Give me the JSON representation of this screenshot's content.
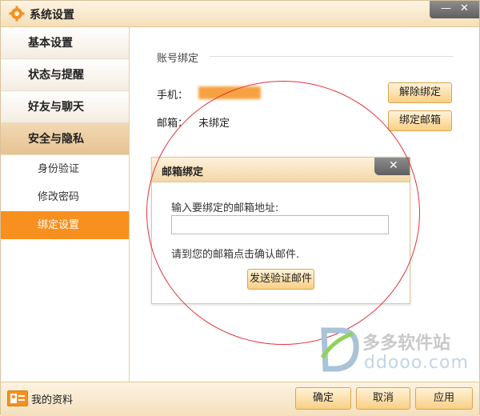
{
  "window": {
    "title": "系统设置",
    "min_icon": "minimize-icon",
    "close_icon": "close-icon"
  },
  "sidebar": {
    "categories": [
      "基本设置",
      "状态与提醒",
      "好友与聊天",
      "安全与隐私"
    ],
    "subitems": [
      "身份验证",
      "修改密码",
      "绑定设置"
    ],
    "active_category": "安全与隐私",
    "active_subitem": "绑定设置"
  },
  "content": {
    "section_title": "账号绑定",
    "phone_label": "手机：",
    "email_label": "邮箱：",
    "email_value": "未绑定",
    "unbind_button": "解除绑定",
    "bind_email_button": "绑定邮箱"
  },
  "dialog": {
    "title": "邮箱绑定",
    "input_label": "输入要绑定的邮箱地址:",
    "input_value": "",
    "note": "请到您的邮箱点击确认邮件.",
    "send_button": "发送验证邮件"
  },
  "watermark": {
    "cn": "多多软件站",
    "en": "ddooo.com"
  },
  "footer": {
    "profile": "我的资料",
    "ok": "确定",
    "cancel": "取消",
    "apply": "应用"
  },
  "colors": {
    "accent": "#f7901e",
    "title_bg": "#f5dfb9",
    "annotation": "#e0323c"
  }
}
